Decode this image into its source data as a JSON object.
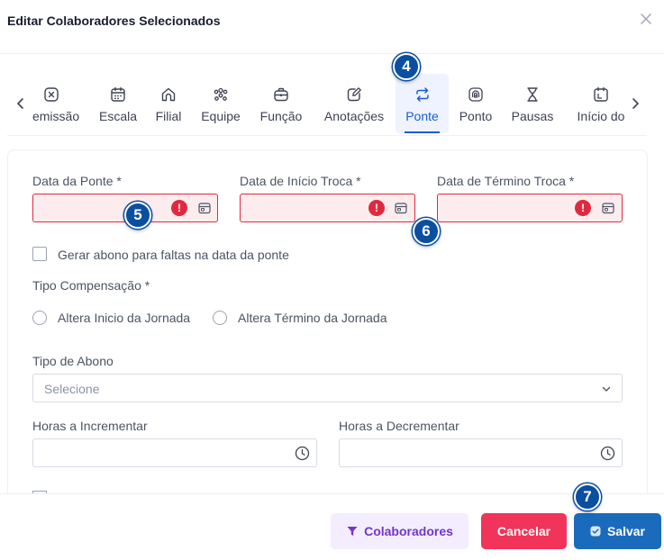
{
  "modal": {
    "title": "Editar Colaboradores Selecionados"
  },
  "tabs": [
    {
      "label": "Demissão",
      "icon": "close-square-icon"
    },
    {
      "label": "Escala",
      "icon": "calendar-icon"
    },
    {
      "label": "Filial",
      "icon": "home-icon"
    },
    {
      "label": "Equipe",
      "icon": "team-icon"
    },
    {
      "label": "Função",
      "icon": "briefcase-icon"
    },
    {
      "label": "Anotações",
      "icon": "edit-note-icon"
    },
    {
      "label": "Ponte",
      "icon": "swap-icon",
      "active": true
    },
    {
      "label": "Ponto",
      "icon": "fingerprint-icon"
    },
    {
      "label": "Pausas",
      "icon": "hourglass-icon"
    },
    {
      "label": "Início do",
      "icon": "calendar-clock-icon"
    }
  ],
  "form": {
    "data_ponte_label": "Data da Ponte *",
    "data_inicio_troca_label": "Data de Início Troca *",
    "data_termino_troca_label": "Data de Término Troca *",
    "error_glyph": "!",
    "gerar_abono_label": "Gerar abono para faltas na data da ponte",
    "tipo_compensacao_label": "Tipo Compensação *",
    "altera_inicio_label": "Altera Inicio da Jornada",
    "altera_termino_label": "Altera Término da Jornada",
    "tipo_abono_label": "Tipo de Abono",
    "tipo_abono_placeholder": "Selecione",
    "horas_incrementar_label": "Horas a Incrementar",
    "horas_decrementar_label": "Horas a Decrementar"
  },
  "footer": {
    "colaboradores_label": "Colaboradores",
    "cancelar_label": "Cancelar",
    "salvar_label": "Salvar"
  },
  "badges": [
    "4",
    "5",
    "6",
    "7"
  ],
  "colors": {
    "accent": "#1e5ad6",
    "error": "#e0293f",
    "cancel": "#f1345a",
    "save": "#1b6bbd",
    "badge": "#0a4fa0"
  }
}
